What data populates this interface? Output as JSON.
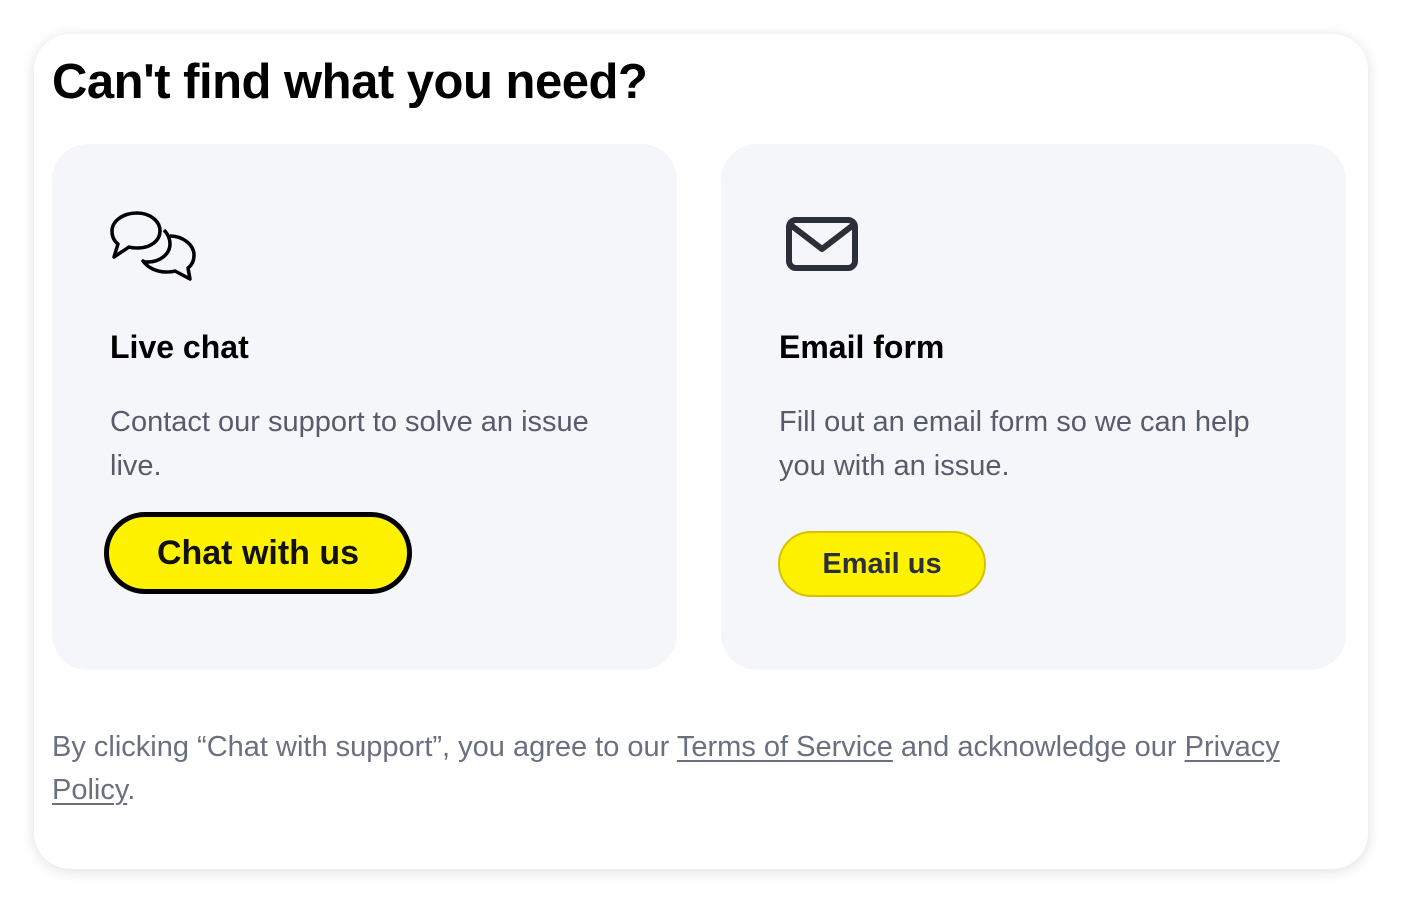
{
  "heading": "Can't find what you need?",
  "live_chat": {
    "icon": "chat-bubbles-icon",
    "title": "Live chat",
    "description": "Contact our support to solve an issue live.",
    "button_label": "Chat with us"
  },
  "email_form": {
    "icon": "envelope-icon",
    "title": "Email form",
    "description": "Fill out an email form so we can help you with an issue.",
    "button_label": "Email us"
  },
  "legal": {
    "prefix": "By clicking “Chat with support”, you agree to our ",
    "terms_link": "Terms of Service",
    "middle": " and acknowledge our ",
    "privacy_link": "Privacy Policy",
    "suffix": "."
  },
  "colors": {
    "accent": "#fff200",
    "card_background": "#f5f6fa",
    "body_text": "#575c6b",
    "legal_text": "#6b7080"
  }
}
